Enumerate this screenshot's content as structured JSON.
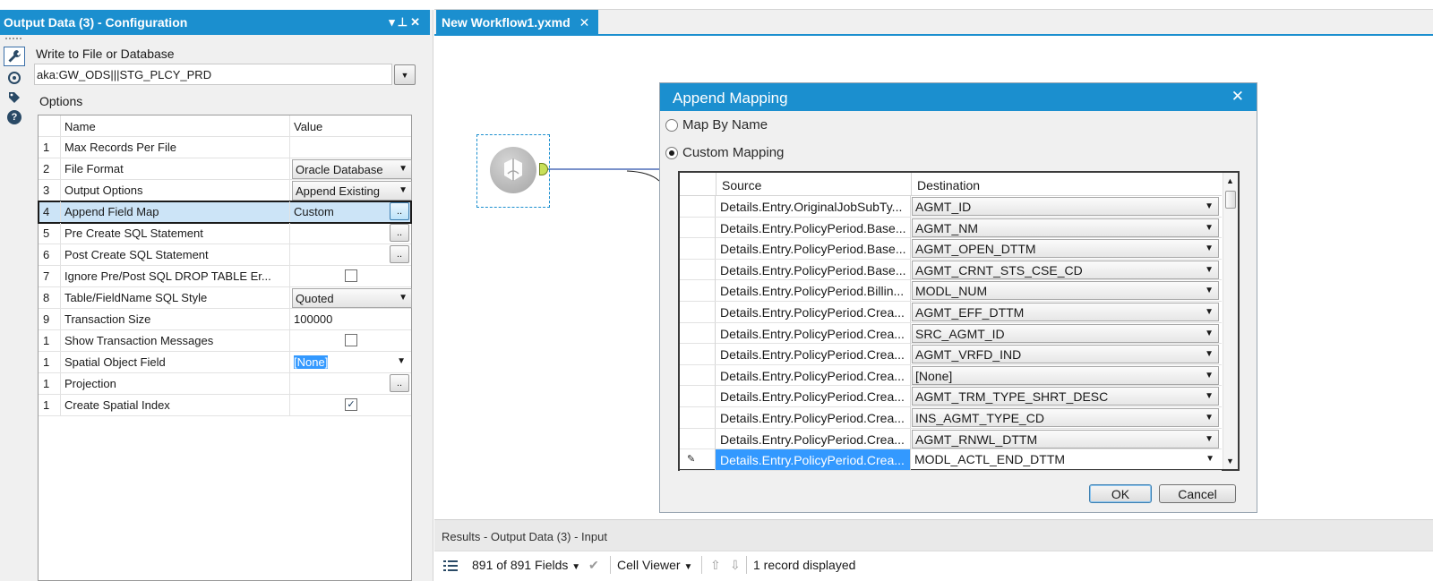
{
  "config_panel": {
    "title": "Output Data (3) - Configuration",
    "controls": {
      "dropdown": "▾",
      "pin": "⊥",
      "close": "✕"
    },
    "write_label": "Write to File or Database",
    "write_value": "aka:GW_ODS|||STG_PLCY_PRD",
    "options_label": "Options",
    "grid": {
      "columns": {
        "name": "Name",
        "value": "Value"
      },
      "rows": [
        {
          "num": "1",
          "name": "Max Records Per File",
          "value": ""
        },
        {
          "num": "2",
          "name": "File Format",
          "value": "Oracle Database"
        },
        {
          "num": "3",
          "name": "Output Options",
          "value": "Append Existing"
        },
        {
          "num": "4",
          "name": "Append Field Map",
          "value": "Custom",
          "button": ".."
        },
        {
          "num": "5",
          "name": "Pre Create SQL Statement",
          "value": "",
          "button": ".."
        },
        {
          "num": "6",
          "name": "Post Create SQL Statement",
          "value": "",
          "button": ".."
        },
        {
          "num": "7",
          "name": "Ignore Pre/Post SQL DROP TABLE Er...",
          "checked": false
        },
        {
          "num": "8",
          "name": "Table/FieldName SQL Style",
          "value": "Quoted"
        },
        {
          "num": "9",
          "name": "Transaction Size",
          "value": "100000"
        },
        {
          "num": "1",
          "name": "Show Transaction Messages",
          "checked": false
        },
        {
          "num": "1",
          "name": "Spatial Object Field",
          "value": "[None]"
        },
        {
          "num": "1",
          "name": "Projection",
          "value": "",
          "button": ".."
        },
        {
          "num": "1",
          "name": "Create Spatial Index",
          "checked": true
        }
      ]
    }
  },
  "workflow_tab": {
    "label": "New Workflow1.yxmd",
    "close": "✕"
  },
  "dialog": {
    "title": "Append Mapping",
    "close": "✕",
    "radio_map_by_name": "Map By Name",
    "radio_custom_mapping": "Custom Mapping",
    "columns": {
      "source": "Source",
      "destination": "Destination"
    },
    "rows": [
      {
        "source": "Details.Entry.OriginalJobSubTy...",
        "destination": "AGMT_ID"
      },
      {
        "source": "Details.Entry.PolicyPeriod.Base...",
        "destination": "AGMT_NM"
      },
      {
        "source": "Details.Entry.PolicyPeriod.Base...",
        "destination": "AGMT_OPEN_DTTM"
      },
      {
        "source": "Details.Entry.PolicyPeriod.Base...",
        "destination": "AGMT_CRNT_STS_CSE_CD"
      },
      {
        "source": "Details.Entry.PolicyPeriod.Billin...",
        "destination": "MODL_NUM"
      },
      {
        "source": "Details.Entry.PolicyPeriod.Crea...",
        "destination": "AGMT_EFF_DTTM"
      },
      {
        "source": "Details.Entry.PolicyPeriod.Crea...",
        "destination": "SRC_AGMT_ID"
      },
      {
        "source": "Details.Entry.PolicyPeriod.Crea...",
        "destination": "AGMT_VRFD_IND"
      },
      {
        "source": "Details.Entry.PolicyPeriod.Crea...",
        "destination": "[None]"
      },
      {
        "source": "Details.Entry.PolicyPeriod.Crea...",
        "destination": "AGMT_TRM_TYPE_SHRT_DESC"
      },
      {
        "source": "Details.Entry.PolicyPeriod.Crea...",
        "destination": "INS_AGMT_TYPE_CD"
      },
      {
        "source": "Details.Entry.PolicyPeriod.Crea...",
        "destination": "AGMT_RNWL_DTTM"
      },
      {
        "source": "Details.Entry.PolicyPeriod.Crea...",
        "destination": "MODL_ACTL_END_DTTM",
        "current": true
      }
    ],
    "ok_label": "OK",
    "cancel_label": "Cancel"
  },
  "results": {
    "title": "Results - Output Data (3) - Input",
    "fields_label": "891 of 891 Fields",
    "cell_viewer_label": "Cell Viewer",
    "records_label": "1 record displayed"
  },
  "icons": [
    "wrench-icon",
    "connection-icon",
    "tag-icon",
    "help-icon",
    "output-data-tool-icon"
  ],
  "colors": {
    "accent": "#1b8fcf",
    "selection": "#3399ff",
    "selected_row": "#cce4f7"
  }
}
